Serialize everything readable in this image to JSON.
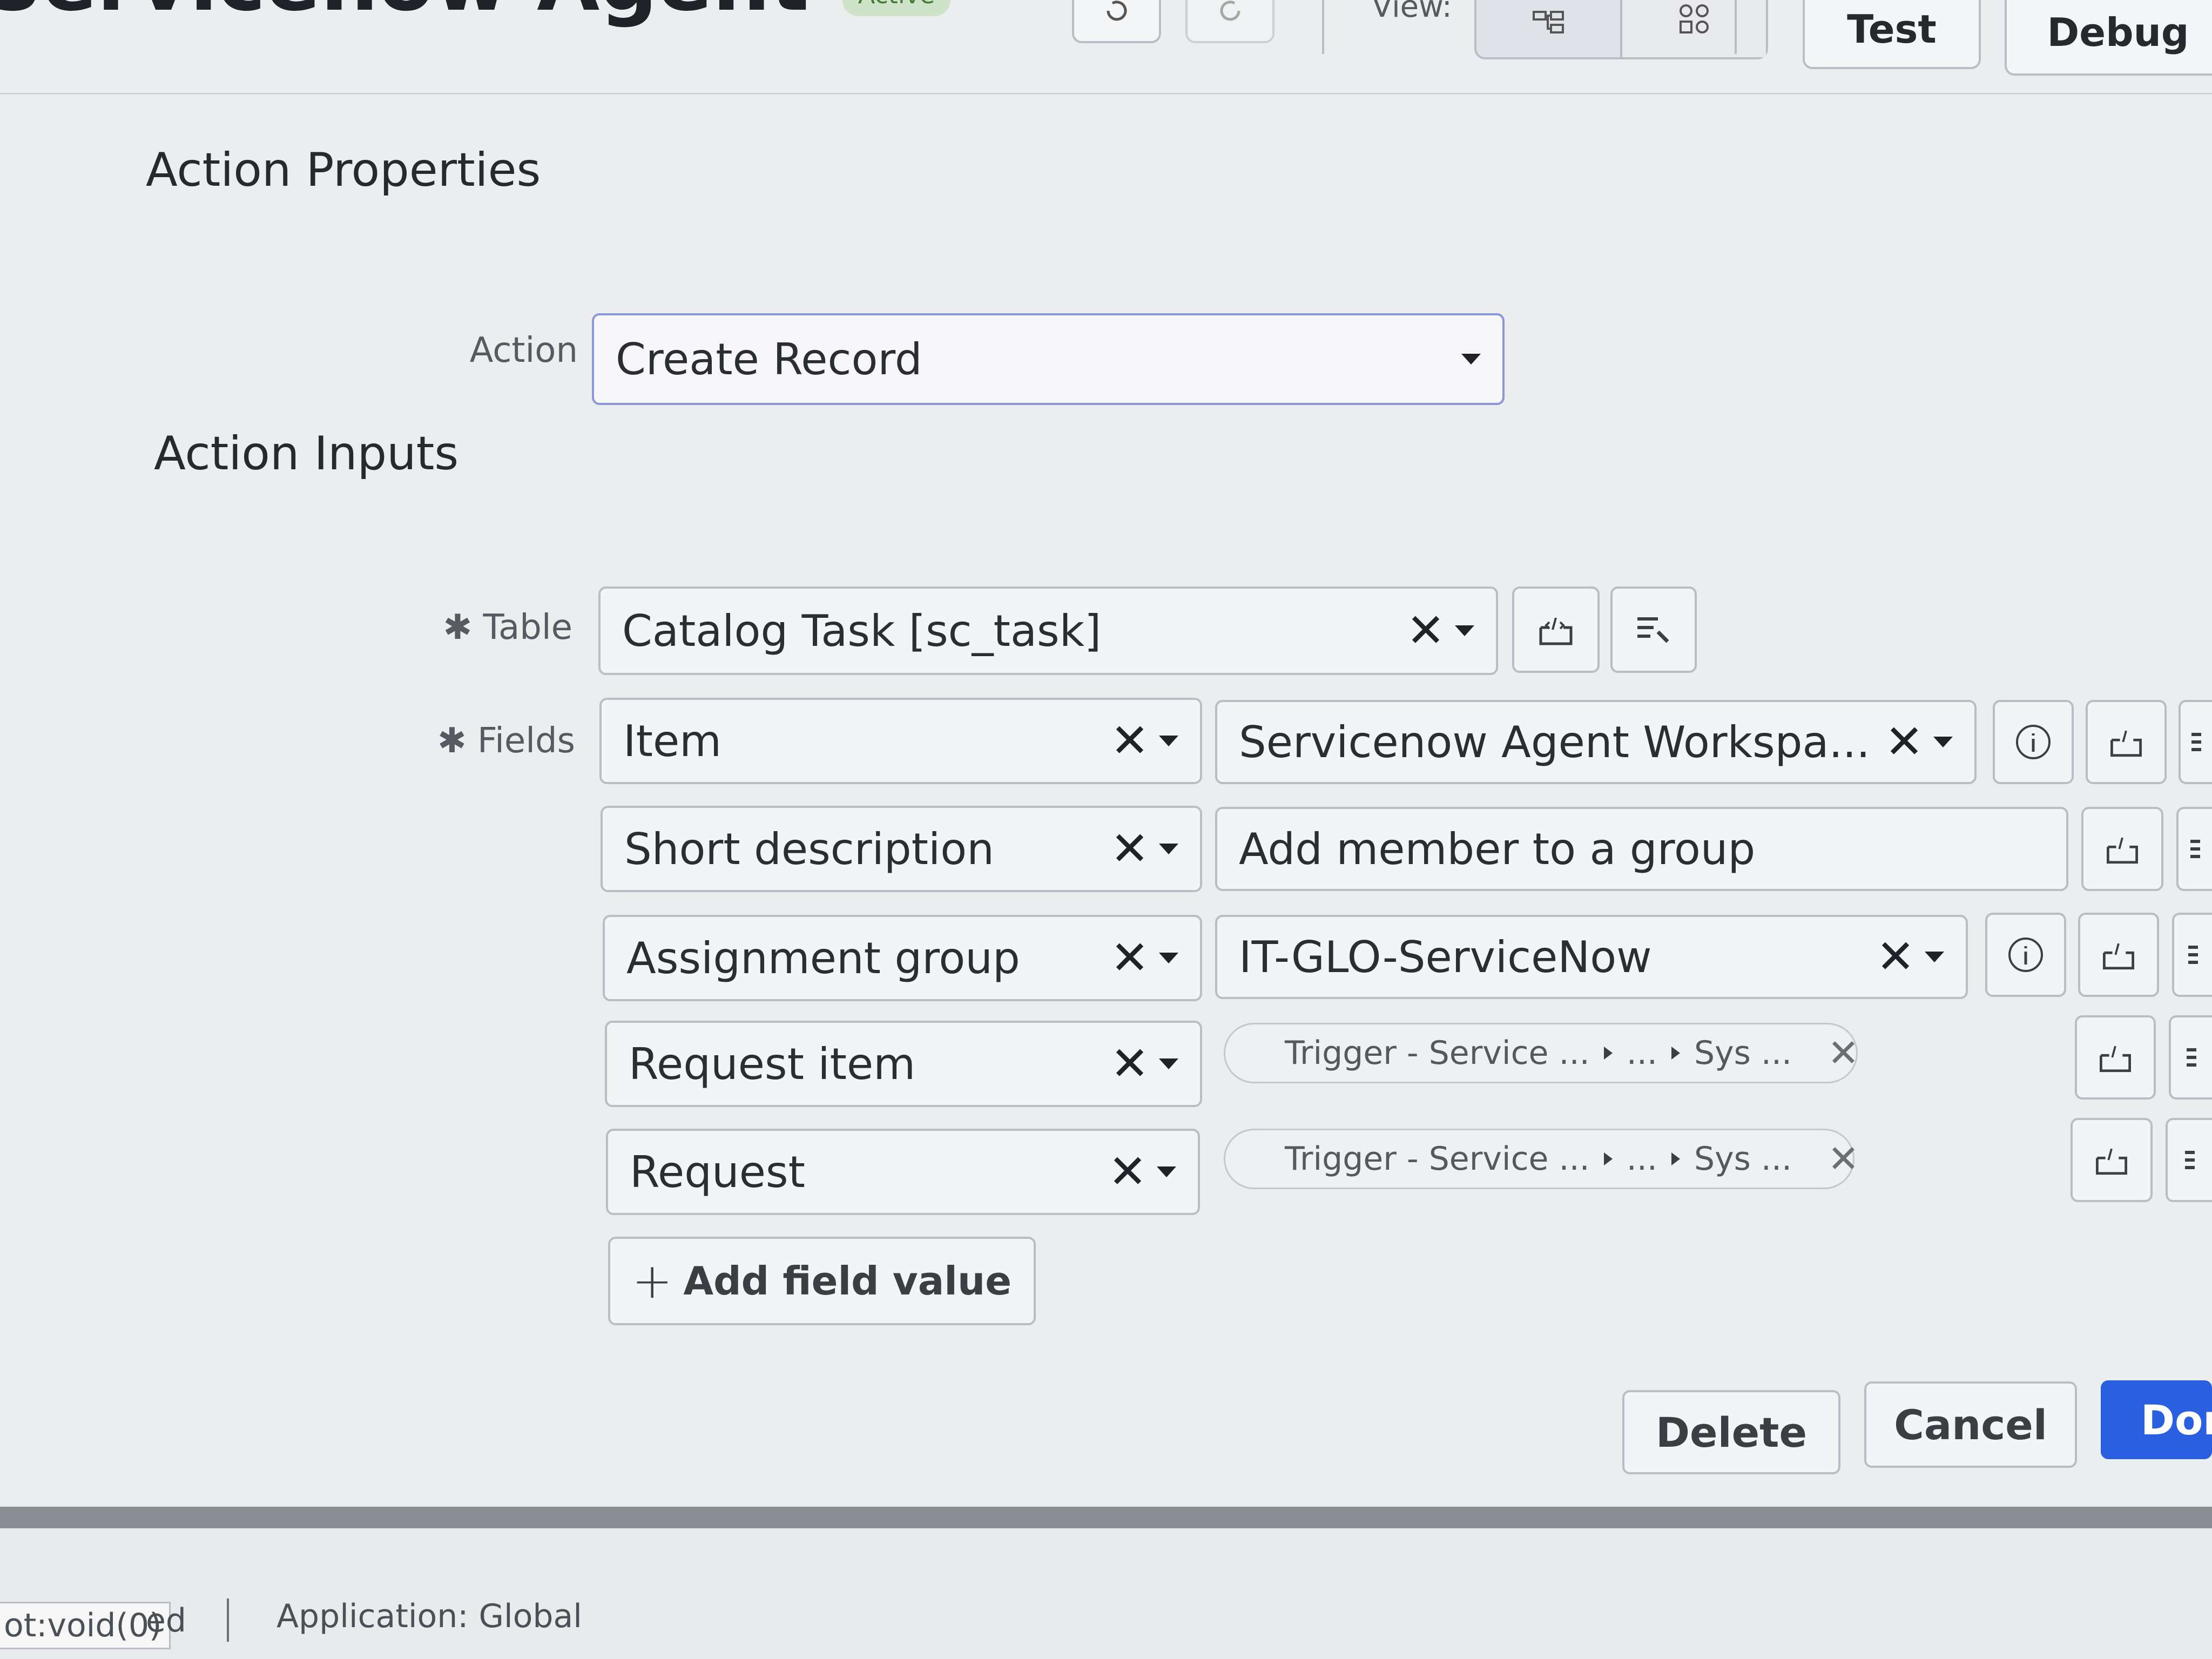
{
  "header": {
    "title": "Servicenow Agent ...",
    "status": "Active",
    "view_label": "View:",
    "test_label": "Test",
    "debug_label": "Debug"
  },
  "action_properties": {
    "heading": "Action Properties",
    "action_label": "Action",
    "action_value": "Create Record"
  },
  "action_inputs": {
    "heading": "Action Inputs",
    "table_label": "Table",
    "table_value": "Catalog Task [sc_task]",
    "fields_label": "Fields",
    "rows": [
      {
        "field": "Item",
        "value": "Servicenow Agent Workspa..."
      },
      {
        "field": "Short description",
        "value": "Add member to a group"
      },
      {
        "field": "Assignment group",
        "value": "IT-GLO-ServiceNow"
      },
      {
        "field": "Request item",
        "pill": [
          "Trigger - Service ...",
          "...",
          "Sys ..."
        ]
      },
      {
        "field": "Request",
        "pill": [
          "Trigger - Service ...",
          "...",
          "Sys ..."
        ]
      }
    ],
    "add_field_label": "Add field value"
  },
  "footer": {
    "delete_label": "Delete",
    "cancel_label": "Cancel",
    "done_label": "Don"
  },
  "statusbar": {
    "link_text": "ot:void(0)",
    "partial": "ed",
    "application": "Application: Global"
  },
  "colors": {
    "primary": "#2a5fe0",
    "background": "#ecedee",
    "border": "#b9bec4"
  }
}
